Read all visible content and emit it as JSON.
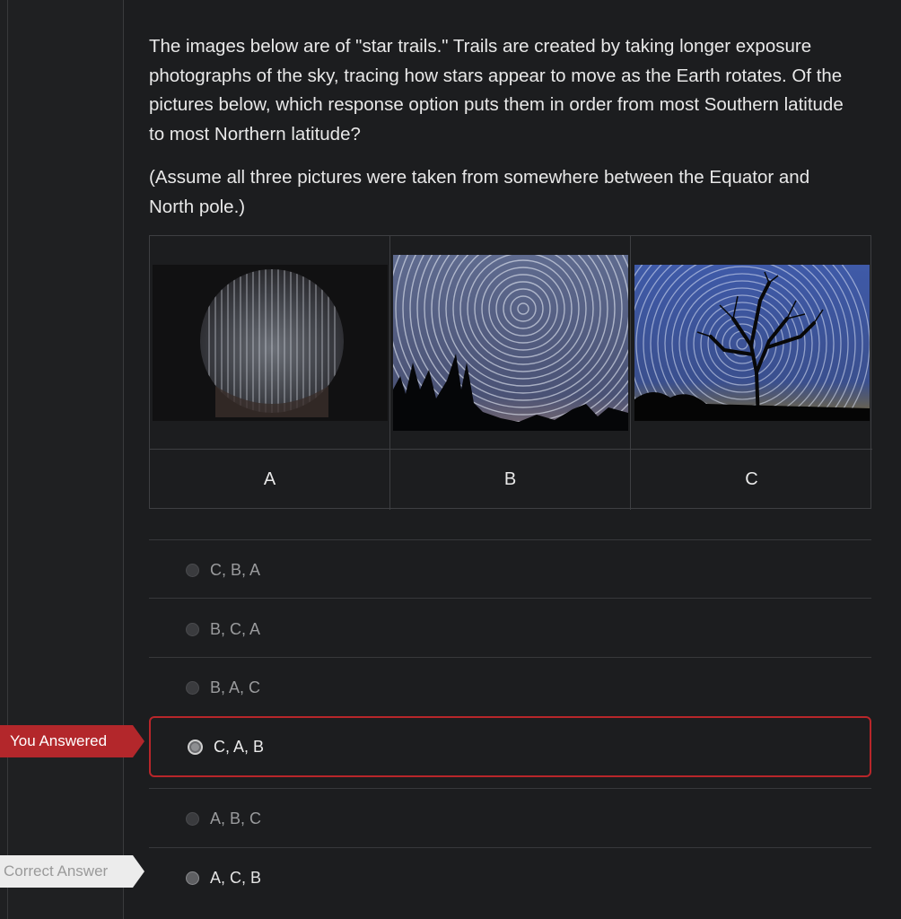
{
  "question": {
    "paragraph_1": "The images below are of \"star trails.\" Trails are created by taking longer exposure photographs of the sky, tracing how stars appear to move as the Earth rotates. Of the pictures below, which response option puts them in order from most Southern latitude to most Northern latitude?",
    "paragraph_2": "(Assume all three pictures were taken from somewhere between the Equator and North pole.)"
  },
  "images": [
    {
      "label": "A",
      "icon": "star-trails-fisheye-photo"
    },
    {
      "label": "B",
      "icon": "star-trails-circular-pines-photo"
    },
    {
      "label": "C",
      "icon": "star-trails-tree-silhouette-photo"
    }
  ],
  "options": [
    {
      "text": "C, B, A"
    },
    {
      "text": "B, C, A"
    },
    {
      "text": "B, A, C"
    },
    {
      "text": "C, A, B"
    },
    {
      "text": "A, B, C"
    },
    {
      "text": "A, C, B"
    }
  ],
  "tags": {
    "you_answered": "You Answered",
    "correct_answer": "Correct Answer"
  },
  "colors": {
    "background": "#1c1d1f",
    "selected_border": "#b8262a",
    "you_answered_tag": "#b3272b",
    "correct_tag": "#ececec"
  }
}
